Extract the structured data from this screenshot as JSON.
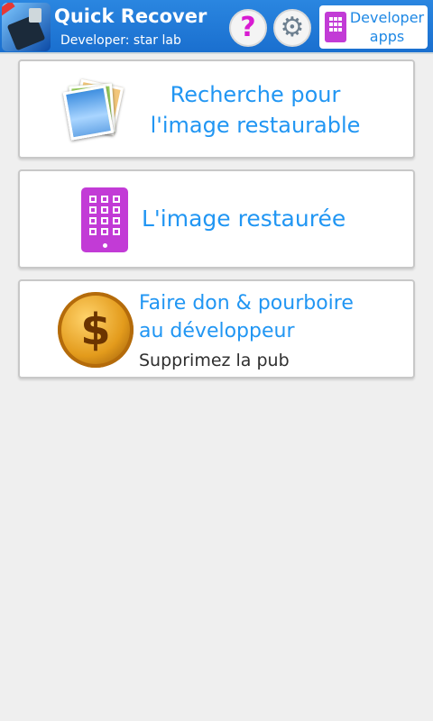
{
  "header": {
    "title": "Quick Recover",
    "developer": "Developer: star lab",
    "help_icon": "question-mark-icon",
    "help_glyph": "?",
    "settings_icon": "gear-icon",
    "settings_glyph": "⚙",
    "developer_apps": {
      "line1": "Developer",
      "line2": "apps"
    },
    "accent_color": "#1e78d8"
  },
  "menu": {
    "search": {
      "line1": "Recherche pour",
      "line2": "l'image restaurable",
      "icon": "photos-icon"
    },
    "restored": {
      "label": "L'image restaurée",
      "icon": "tablet-icon"
    },
    "donate": {
      "line1": "Faire don & pourboire",
      "line2": "au développeur",
      "line3": "Supprimez la pub",
      "icon": "dollar-coin-icon",
      "coin_glyph": "$"
    }
  }
}
